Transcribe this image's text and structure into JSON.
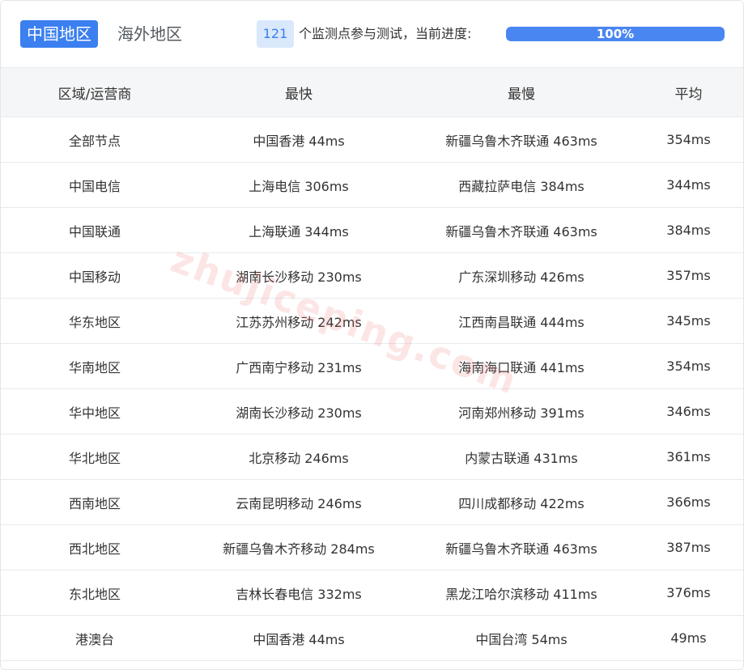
{
  "tabs": [
    {
      "label": "中国地区",
      "active": true
    },
    {
      "label": "海外地区",
      "active": false
    }
  ],
  "progress": {
    "node_count": "121",
    "label": "个监测点参与测试，当前进度:",
    "percent_text": "100%",
    "percent": 100
  },
  "table": {
    "headers": [
      "区域/运营商",
      "最快",
      "最慢",
      "平均"
    ],
    "rows": [
      [
        "全部节点",
        "中国香港 44ms",
        "新疆乌鲁木齐联通 463ms",
        "354ms"
      ],
      [
        "中国电信",
        "上海电信 306ms",
        "西藏拉萨电信 384ms",
        "344ms"
      ],
      [
        "中国联通",
        "上海联通 344ms",
        "新疆乌鲁木齐联通 463ms",
        "384ms"
      ],
      [
        "中国移动",
        "湖南长沙移动 230ms",
        "广东深圳移动 426ms",
        "357ms"
      ],
      [
        "华东地区",
        "江苏苏州移动 242ms",
        "江西南昌联通 444ms",
        "345ms"
      ],
      [
        "华南地区",
        "广西南宁移动 231ms",
        "海南海口联通 441ms",
        "354ms"
      ],
      [
        "华中地区",
        "湖南长沙移动 230ms",
        "河南郑州移动 391ms",
        "346ms"
      ],
      [
        "华北地区",
        "北京移动 246ms",
        "内蒙古联通 431ms",
        "361ms"
      ],
      [
        "西南地区",
        "云南昆明移动 246ms",
        "四川成都移动 422ms",
        "366ms"
      ],
      [
        "西北地区",
        "新疆乌鲁木齐移动 284ms",
        "新疆乌鲁木齐联通 463ms",
        "387ms"
      ],
      [
        "东北地区",
        "吉林长春电信 332ms",
        "黑龙江哈尔滨移动 411ms",
        "376ms"
      ],
      [
        "港澳台",
        "中国香港 44ms",
        "中国台湾 54ms",
        "49ms"
      ]
    ]
  },
  "watermark": "zhujiceping.com",
  "colors": {
    "accent": "#3b7ff0",
    "badge_bg": "#d9e8fb",
    "header_bg": "#f5f6f7",
    "progress_fill": "#4a86f2",
    "watermark": "#f06e6e"
  }
}
